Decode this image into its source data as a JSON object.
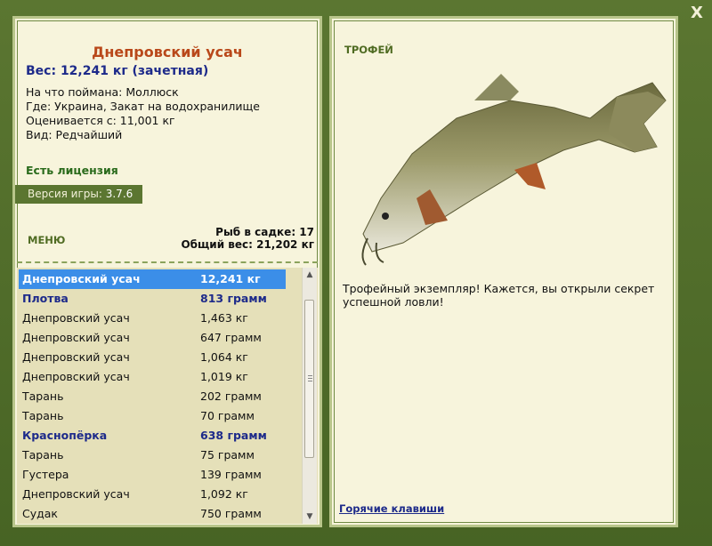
{
  "fish_card": {
    "title": "Днепровский усач",
    "weight": "Вес: 12,241 кг (зачетная)",
    "caught_on": "На что поймана: Моллюск",
    "location": "Где: Украина, Закат на водохранилище",
    "valued_from": "Оценивается с: 11,001 кг",
    "type": "Вид: Редчайший"
  },
  "license": "Есть лицензия",
  "version": {
    "label": "Версия игры:",
    "value": "3.7.6"
  },
  "menu_label": "МЕНЮ",
  "counts": {
    "fish_in_cage": "Рыб в садке: 17",
    "total_weight": "Общий вес: 21,202 кг"
  },
  "catch_list": [
    {
      "name": "Днепровский усач",
      "weight": "12,241 кг",
      "style": "selected"
    },
    {
      "name": "Плотва",
      "weight": "813 грамм",
      "style": "bold"
    },
    {
      "name": "Днепровский усач",
      "weight": "1,463 кг",
      "style": "normal"
    },
    {
      "name": "Днепровский усач",
      "weight": "647 грамм",
      "style": "normal"
    },
    {
      "name": "Днепровский усач",
      "weight": "1,064 кг",
      "style": "normal"
    },
    {
      "name": "Днепровский усач",
      "weight": "1,019 кг",
      "style": "normal"
    },
    {
      "name": "Тарань",
      "weight": "202 грамм",
      "style": "normal"
    },
    {
      "name": "Тарань",
      "weight": "70 грамм",
      "style": "normal"
    },
    {
      "name": "Краснопёрка",
      "weight": "638 грамм",
      "style": "bold"
    },
    {
      "name": "Тарань",
      "weight": "75 грамм",
      "style": "normal"
    },
    {
      "name": "Густера",
      "weight": "139 грамм",
      "style": "normal"
    },
    {
      "name": "Днепровский усач",
      "weight": "1,092 кг",
      "style": "normal"
    },
    {
      "name": "Судак",
      "weight": "750 грамм",
      "style": "normal"
    }
  ],
  "trophy_label": "ТРОФЕЙ",
  "description": "Трофейный экземпляр! Кажется, вы открыли секрет успешной ловли!",
  "hotkeys_link": "Горячие клавиши",
  "close_label": "X",
  "colors": {
    "frame": "#4e6a2a",
    "panel": "#f7f4dc",
    "selection": "#3b8ee8",
    "title": "#b9481a",
    "accent_blue": "#1d2a8a"
  }
}
